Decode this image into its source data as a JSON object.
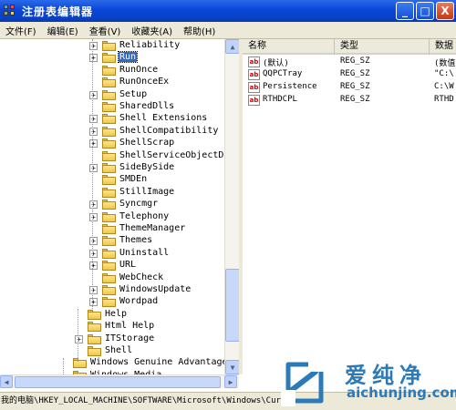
{
  "window": {
    "title": "注册表编辑器"
  },
  "window_buttons": {
    "minimize": "_",
    "maximize": "□",
    "close": "X"
  },
  "menu": [
    "文件(F)",
    "编辑(E)",
    "查看(V)",
    "收藏夹(A)",
    "帮助(H)"
  ],
  "tree": {
    "items": [
      {
        "label": "Reliability",
        "expander": "+",
        "selected": false
      },
      {
        "label": "Run",
        "expander": "+",
        "selected": true
      },
      {
        "label": "RunOnce",
        "expander": "",
        "selected": false
      },
      {
        "label": "RunOnceEx",
        "expander": "",
        "selected": false
      },
      {
        "label": "Setup",
        "expander": "+",
        "selected": false
      },
      {
        "label": "SharedDlls",
        "expander": "",
        "selected": false
      },
      {
        "label": "Shell Extensions",
        "expander": "+",
        "selected": false
      },
      {
        "label": "ShellCompatibility",
        "expander": "+",
        "selected": false
      },
      {
        "label": "ShellScrap",
        "expander": "+",
        "selected": false
      },
      {
        "label": "ShellServiceObjectDelay",
        "expander": "",
        "selected": false
      },
      {
        "label": "SideBySide",
        "expander": "+",
        "selected": false
      },
      {
        "label": "SMDEn",
        "expander": "",
        "selected": false
      },
      {
        "label": "StillImage",
        "expander": "",
        "selected": false
      },
      {
        "label": "Syncmgr",
        "expander": "+",
        "selected": false
      },
      {
        "label": "Telephony",
        "expander": "+",
        "selected": false
      },
      {
        "label": "ThemeManager",
        "expander": "",
        "selected": false
      },
      {
        "label": "Themes",
        "expander": "+",
        "selected": false
      },
      {
        "label": "Uninstall",
        "expander": "+",
        "selected": false
      },
      {
        "label": "URL",
        "expander": "+",
        "selected": false
      },
      {
        "label": "WebCheck",
        "expander": "",
        "selected": false
      },
      {
        "label": "WindowsUpdate",
        "expander": "+",
        "selected": false
      },
      {
        "label": "Wordpad",
        "expander": "+",
        "selected": false
      },
      {
        "label": "Help",
        "expander": "",
        "selected": false
      },
      {
        "label": "Html Help",
        "expander": "",
        "selected": false
      },
      {
        "label": "ITStorage",
        "expander": "+",
        "selected": false
      },
      {
        "label": "Shell",
        "expander": "",
        "selected": false
      },
      {
        "label": "Windows Genuine Advantage",
        "expander": "",
        "selected": false
      },
      {
        "label": "Windows Media",
        "expander": "",
        "selected": false
      }
    ]
  },
  "list": {
    "columns": [
      "名称",
      "类型",
      "数据"
    ],
    "rows": [
      {
        "icon": "ab",
        "name": "(默认)",
        "type": "REG_SZ",
        "data": "(数值"
      },
      {
        "icon": "ab",
        "name": "QQPCTray",
        "type": "REG_SZ",
        "data": "\"C:\\"
      },
      {
        "icon": "ab",
        "name": "Persistence",
        "type": "REG_SZ",
        "data": "C:\\W"
      },
      {
        "icon": "ab",
        "name": "RTHDCPL",
        "type": "REG_SZ",
        "data": "RTHD"
      }
    ]
  },
  "status": {
    "path": "我的电脑\\HKEY_LOCAL_MACHINE\\SOFTWARE\\Microsoft\\Windows\\Curren"
  },
  "watermark": {
    "cn": "爱纯净",
    "en": "aichunjing.com"
  },
  "colors": {
    "titlebar": "#0a46d8",
    "selection": "#316ac5",
    "watermark": "#2c7ab8"
  }
}
